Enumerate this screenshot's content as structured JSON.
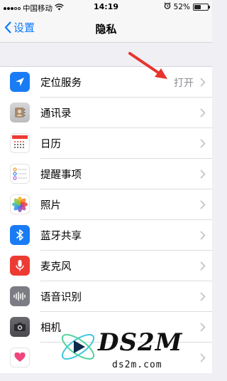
{
  "status_bar": {
    "carrier": "中国移动",
    "time": "14:19",
    "battery_percent": "52%",
    "battery_level": 0.52,
    "icons": [
      "signal-icon",
      "wifi-icon",
      "alarm-icon",
      "battery-icon"
    ]
  },
  "nav": {
    "back_label": "设置",
    "title": "隐私"
  },
  "rows": [
    {
      "label": "定位服务",
      "value": "打开",
      "icon": "location-icon",
      "color": "#1a7cf5"
    },
    {
      "label": "通讯录",
      "value": "",
      "icon": "contacts-icon",
      "color": "#c9c9cc"
    },
    {
      "label": "日历",
      "value": "",
      "icon": "calendar-icon",
      "color": "#ffffff"
    },
    {
      "label": "提醒事项",
      "value": "",
      "icon": "reminders-icon",
      "color": "#ffffff"
    },
    {
      "label": "照片",
      "value": "",
      "icon": "photos-icon",
      "color": "#ffffff"
    },
    {
      "label": "蓝牙共享",
      "value": "",
      "icon": "bluetooth-icon",
      "color": "#1a7cf5"
    },
    {
      "label": "麦克风",
      "value": "",
      "icon": "microphone-icon",
      "color": "#ec3b33"
    },
    {
      "label": "语音识别",
      "value": "",
      "icon": "speech-recognition-icon",
      "color": "#7c7c84"
    },
    {
      "label": "相机",
      "value": "",
      "icon": "camera-icon",
      "color": "#5a5a60"
    },
    {
      "label": "",
      "value": "",
      "icon": "health-icon",
      "color": "#ffffff"
    }
  ],
  "annotation": {
    "arrow_color": "#e8332e",
    "arrow_icon": "red-arrow-icon"
  },
  "watermark": {
    "brand": "DS2M",
    "site": "ds2m.com"
  }
}
